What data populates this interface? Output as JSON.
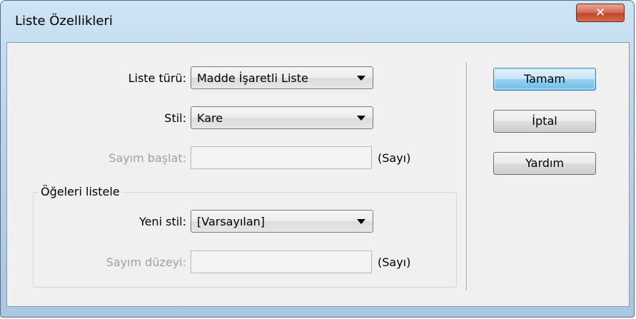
{
  "dialog": {
    "title": "Liste Özellikleri",
    "close_icon": "close-icon"
  },
  "form": {
    "list_type_label": "Liste türü:",
    "list_type_value": "Madde İşaretli Liste",
    "style_label": "Stil:",
    "style_value": "Kare",
    "start_count_label": "Sayım başlat:",
    "start_count_value": "",
    "start_count_unit": "(Sayı)",
    "list_items_group": "Öğeleri listele",
    "new_style_label": "Yeni stil:",
    "new_style_value": "[Varsayılan]",
    "count_level_label": "Sayım düzeyi:",
    "count_level_value": "",
    "count_level_unit": "(Sayı)"
  },
  "buttons": {
    "ok": "Tamam",
    "cancel": "İptal",
    "help": "Yardım"
  }
}
